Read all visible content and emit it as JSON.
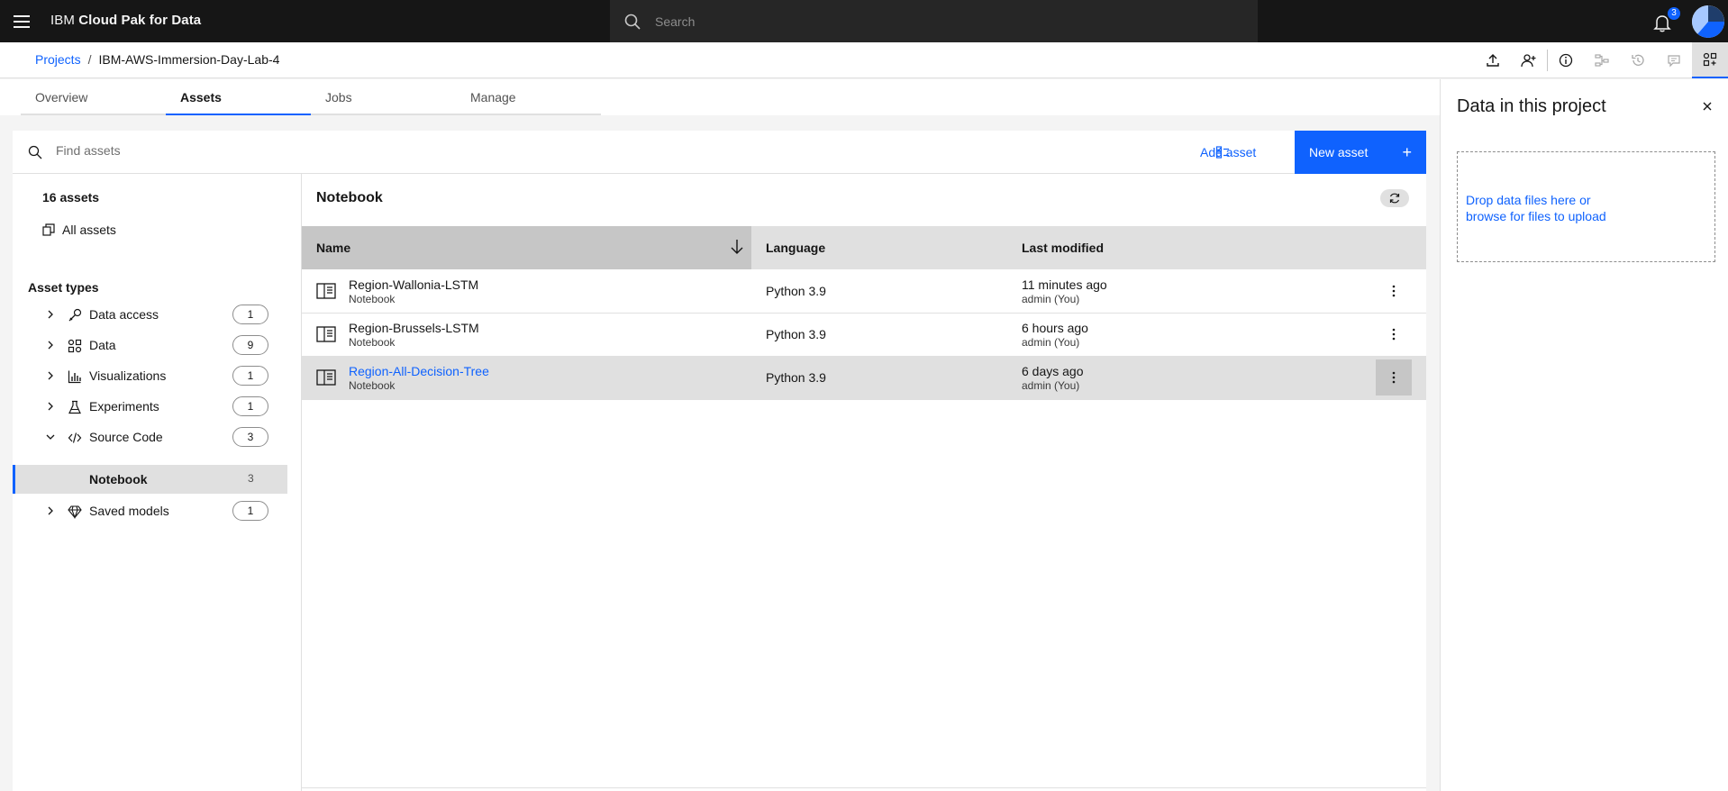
{
  "header": {
    "brand_prefix": "IBM",
    "brand_product": "Cloud Pak for Data",
    "search_placeholder": "Search",
    "notification_count": "3"
  },
  "breadcrumb": {
    "root": "Projects",
    "separator": "/",
    "current": "IBM-AWS-Immersion-Day-Lab-4"
  },
  "tabs": [
    {
      "label": "Overview"
    },
    {
      "label": "Assets"
    },
    {
      "label": "Jobs"
    },
    {
      "label": "Manage"
    }
  ],
  "assets": {
    "find_placeholder": "Find assets",
    "add_asset_label": "Add asset",
    "new_asset_label": "New asset",
    "new_asset_icon": "+"
  },
  "filters": {
    "count_label": "16 assets",
    "all_assets_label": "All assets",
    "types_title": "Asset types",
    "types": [
      {
        "label": "Data access",
        "count": "1",
        "icon": "link-icon"
      },
      {
        "label": "Data",
        "count": "9",
        "icon": "data-icon"
      },
      {
        "label": "Visualizations",
        "count": "1",
        "icon": "chart-icon"
      },
      {
        "label": "Experiments",
        "count": "1",
        "icon": "flask-icon"
      },
      {
        "label": "Source Code",
        "count": "3",
        "icon": "code-icon"
      },
      {
        "label": "Saved models",
        "count": "1",
        "icon": "model-icon"
      }
    ],
    "subtype": {
      "label": "Notebook",
      "count": "3"
    }
  },
  "list": {
    "title": "Notebook",
    "columns": {
      "name": "Name",
      "language": "Language",
      "modified": "Last modified"
    },
    "rows": [
      {
        "name": "Region-Wallonia-LSTM",
        "type": "Notebook",
        "language": "Python 3.9",
        "modified": "11 minutes ago",
        "by": "admin (You)"
      },
      {
        "name": "Region-Brussels-LSTM",
        "type": "Notebook",
        "language": "Python 3.9",
        "modified": "6 hours ago",
        "by": "admin (You)"
      },
      {
        "name": "Region-All-Decision-Tree",
        "type": "Notebook",
        "language": "Python 3.9",
        "modified": "6 days ago",
        "by": "admin (You)"
      }
    ]
  },
  "sidepanel": {
    "title": "Data in this project",
    "drop_line1": "Drop data files here or",
    "drop_line2": "browse for files to upload"
  },
  "colors": {
    "accent": "#0f62fe",
    "header_bg": "#161616",
    "selected_row": "#e0e0e0"
  }
}
